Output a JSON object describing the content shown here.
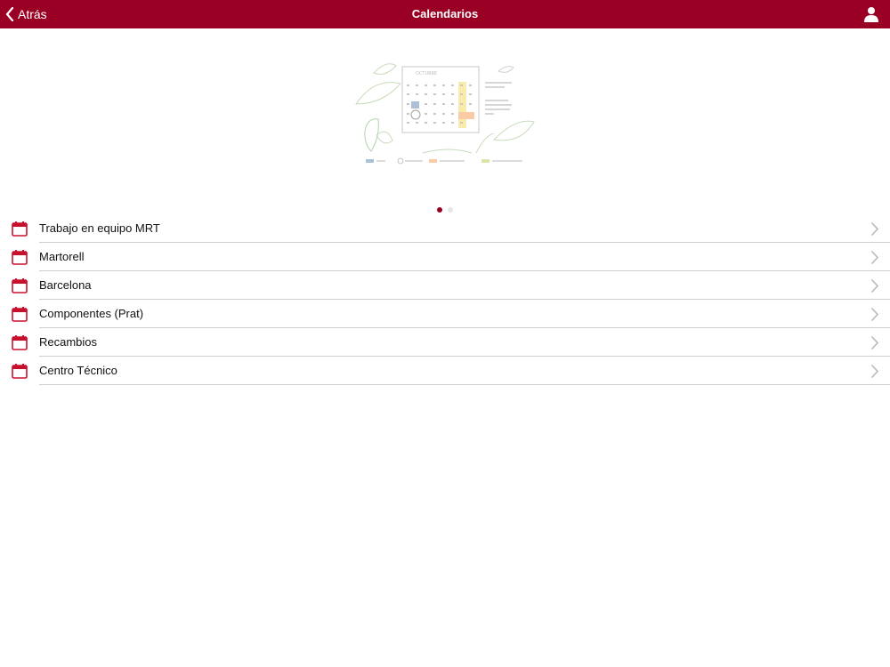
{
  "navbar": {
    "back_label": "Atrás",
    "title": "Calendarios",
    "background_color": "#9a0023",
    "icons": {
      "back": "chevron-left-icon",
      "profile": "user-icon"
    }
  },
  "banner": {
    "calendar_month": "OCTUBRE",
    "weekdays": [
      "L",
      "M",
      "X",
      "J",
      "V",
      "S",
      "D"
    ],
    "days": [
      "1",
      "2",
      "3",
      "4",
      "5",
      "6",
      "7",
      "8",
      "9",
      "10",
      "11",
      "12",
      "13",
      "14",
      "15",
      "16",
      "17",
      "18",
      "19",
      "20",
      "21",
      "22",
      "23",
      "24",
      "25",
      "26",
      "27",
      "28",
      "29",
      "30",
      "31"
    ]
  },
  "carousel": {
    "page_count": 2,
    "active_page": 1
  },
  "list": {
    "accent_color": "#c8102e",
    "items": [
      {
        "label": "Trabajo en equipo MRT"
      },
      {
        "label": "Martorell"
      },
      {
        "label": "Barcelona"
      },
      {
        "label": "Componentes (Prat)"
      },
      {
        "label": "Recambios"
      },
      {
        "label": "Centro Técnico"
      }
    ]
  }
}
